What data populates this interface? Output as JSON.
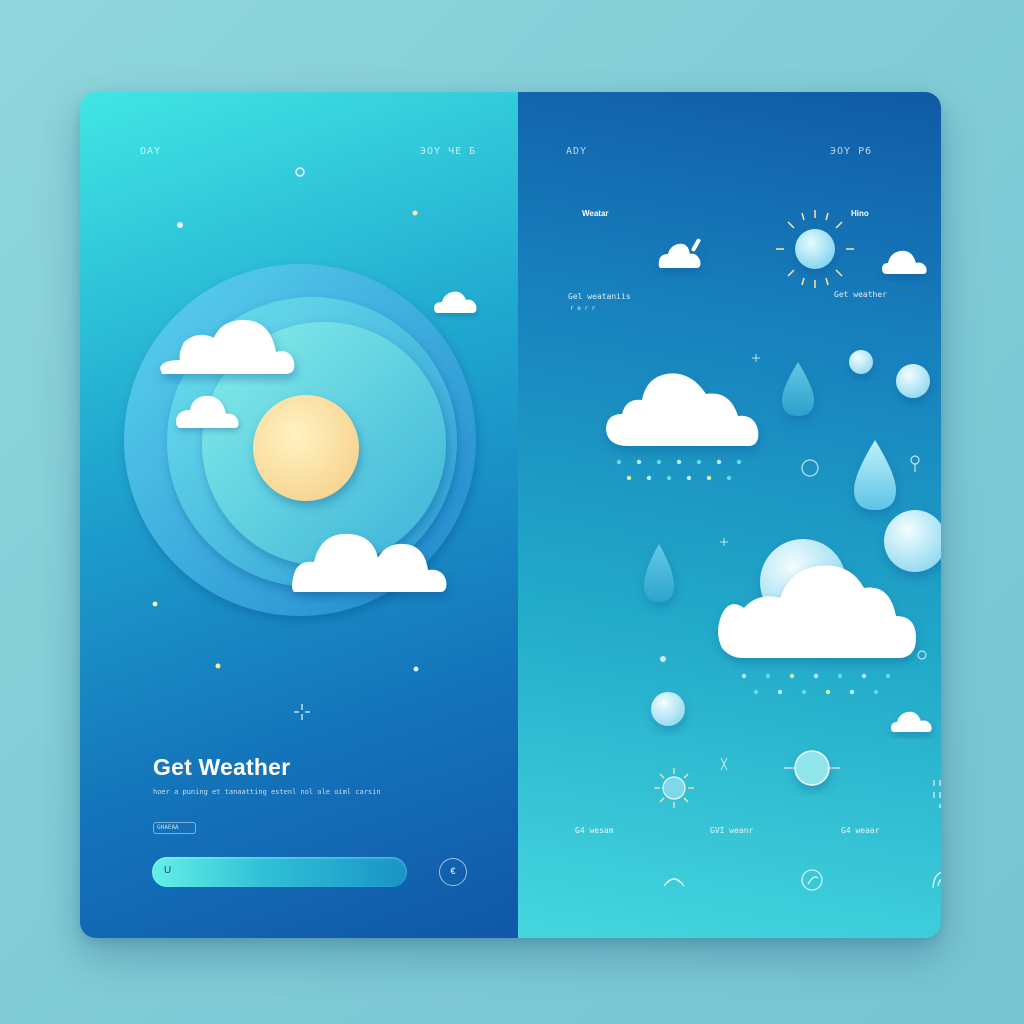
{
  "left": {
    "top_left_label": "ОАҮ",
    "top_right_label": "ЭОҮ ЧЕ Б",
    "title": "Get Weather",
    "description": "hoer a puning et tanaatting estenl nol ole oiml carsin",
    "chip_label": "GHAEAA",
    "input_value": "U",
    "round_button_label": "€"
  },
  "right": {
    "top_left_label": "АDY",
    "top_right_label": "ЭОҮ Р6",
    "col1_heading": "Weatar",
    "col1_caption_line1": "Gel weataniis",
    "col1_caption_line2": "r e r r",
    "col3_heading": "Hino",
    "col3_caption": "Get weather",
    "bottom_caption_1": "G4 wesam",
    "bottom_caption_2": "GVI weanr",
    "bottom_caption_3": "G4 weaar"
  },
  "icons": [
    "sun-icon",
    "cloud-icon",
    "raindrop-icon",
    "rain-cloud-icon",
    "sparkle-icon",
    "wind-icon"
  ],
  "colors": {
    "accent_cyan": "#41e6e4",
    "deep_blue": "#1057a8",
    "sun": "#fde7a6",
    "cloud": "#ffffff"
  }
}
